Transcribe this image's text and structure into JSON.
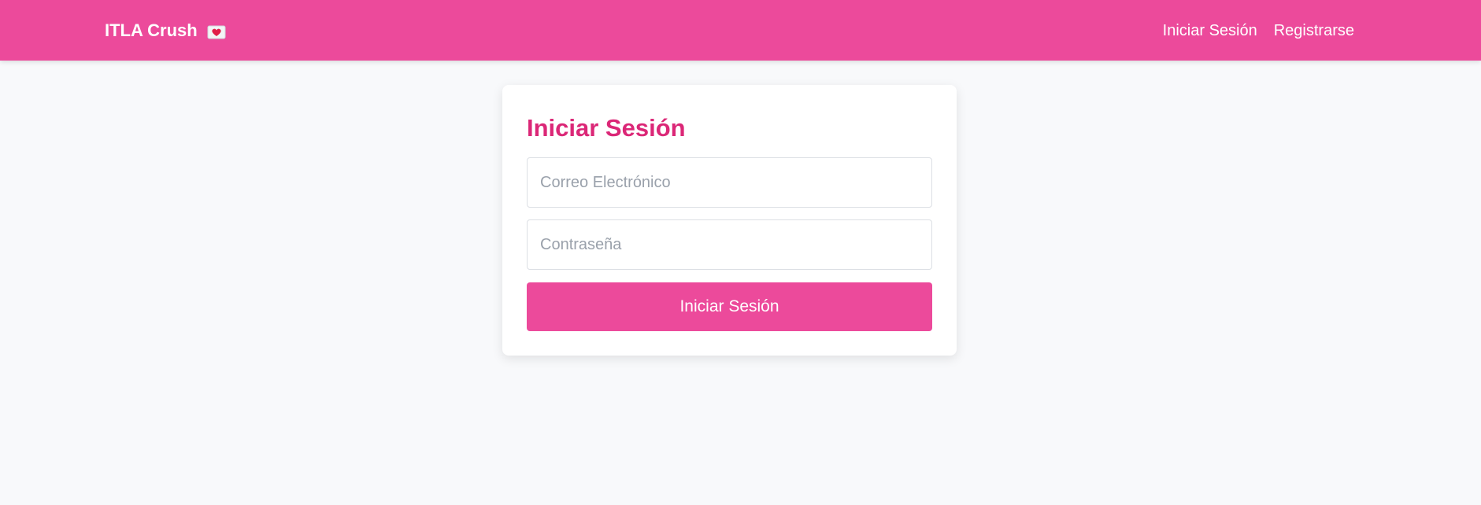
{
  "navbar": {
    "brand": "ITLA Crush",
    "brand_icon": "love-letter-icon",
    "links": [
      {
        "label": "Iniciar Sesión"
      },
      {
        "label": "Registrarse"
      }
    ]
  },
  "login": {
    "title": "Iniciar Sesión",
    "email": {
      "value": "",
      "placeholder": "Correo Electrónico"
    },
    "password": {
      "value": "",
      "placeholder": "Contraseña"
    },
    "submit_label": "Iniciar Sesión"
  },
  "colors": {
    "brand_pink": "#ec4a9b",
    "title_pink": "#db2777",
    "page_background": "#f8f9fb",
    "card_background": "#ffffff"
  }
}
